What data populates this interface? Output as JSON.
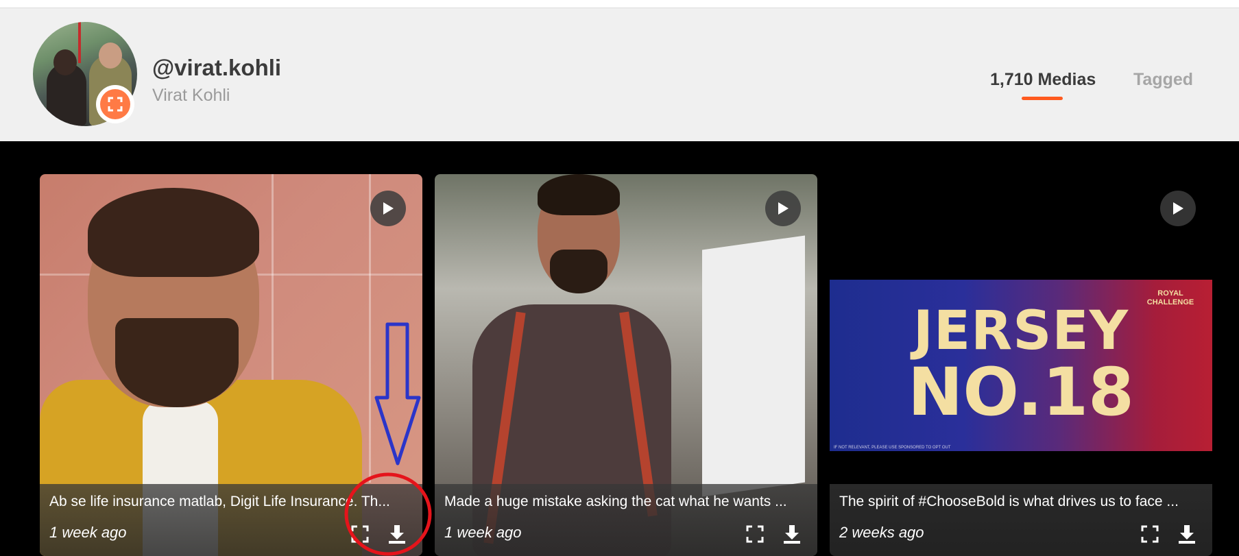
{
  "profile": {
    "username": "@virat.kohli",
    "full_name": "Virat Kohli"
  },
  "tabs": {
    "medias": "1,710 Medias",
    "tagged": "Tagged",
    "active": "medias"
  },
  "accent_color": "#ff5a1f",
  "cards": [
    {
      "caption": "Ab se life insurance matlab, Digit Life Insurance. Th...",
      "time": "1 week ago"
    },
    {
      "caption": "Made a huge mistake asking the cat what he wants ...",
      "time": "1 week ago"
    },
    {
      "caption": "The spirit of #ChooseBold is what drives us to face ...",
      "time": "2 weeks ago",
      "banner": {
        "line1": "JERSEY",
        "line2": "NO.18",
        "brand": "ROYAL CHALLENGE",
        "fine_print": "IF NOT RELEVANT, PLEASE USE SPONSORED TO OPT OUT"
      }
    }
  ],
  "icons": {
    "play": "play-icon",
    "expand": "expand-icon",
    "download": "download-icon",
    "avatar_badge": "expand-icon"
  },
  "annotation_colors": {
    "arrow": "#2b35c9",
    "circle": "#e5141b"
  }
}
